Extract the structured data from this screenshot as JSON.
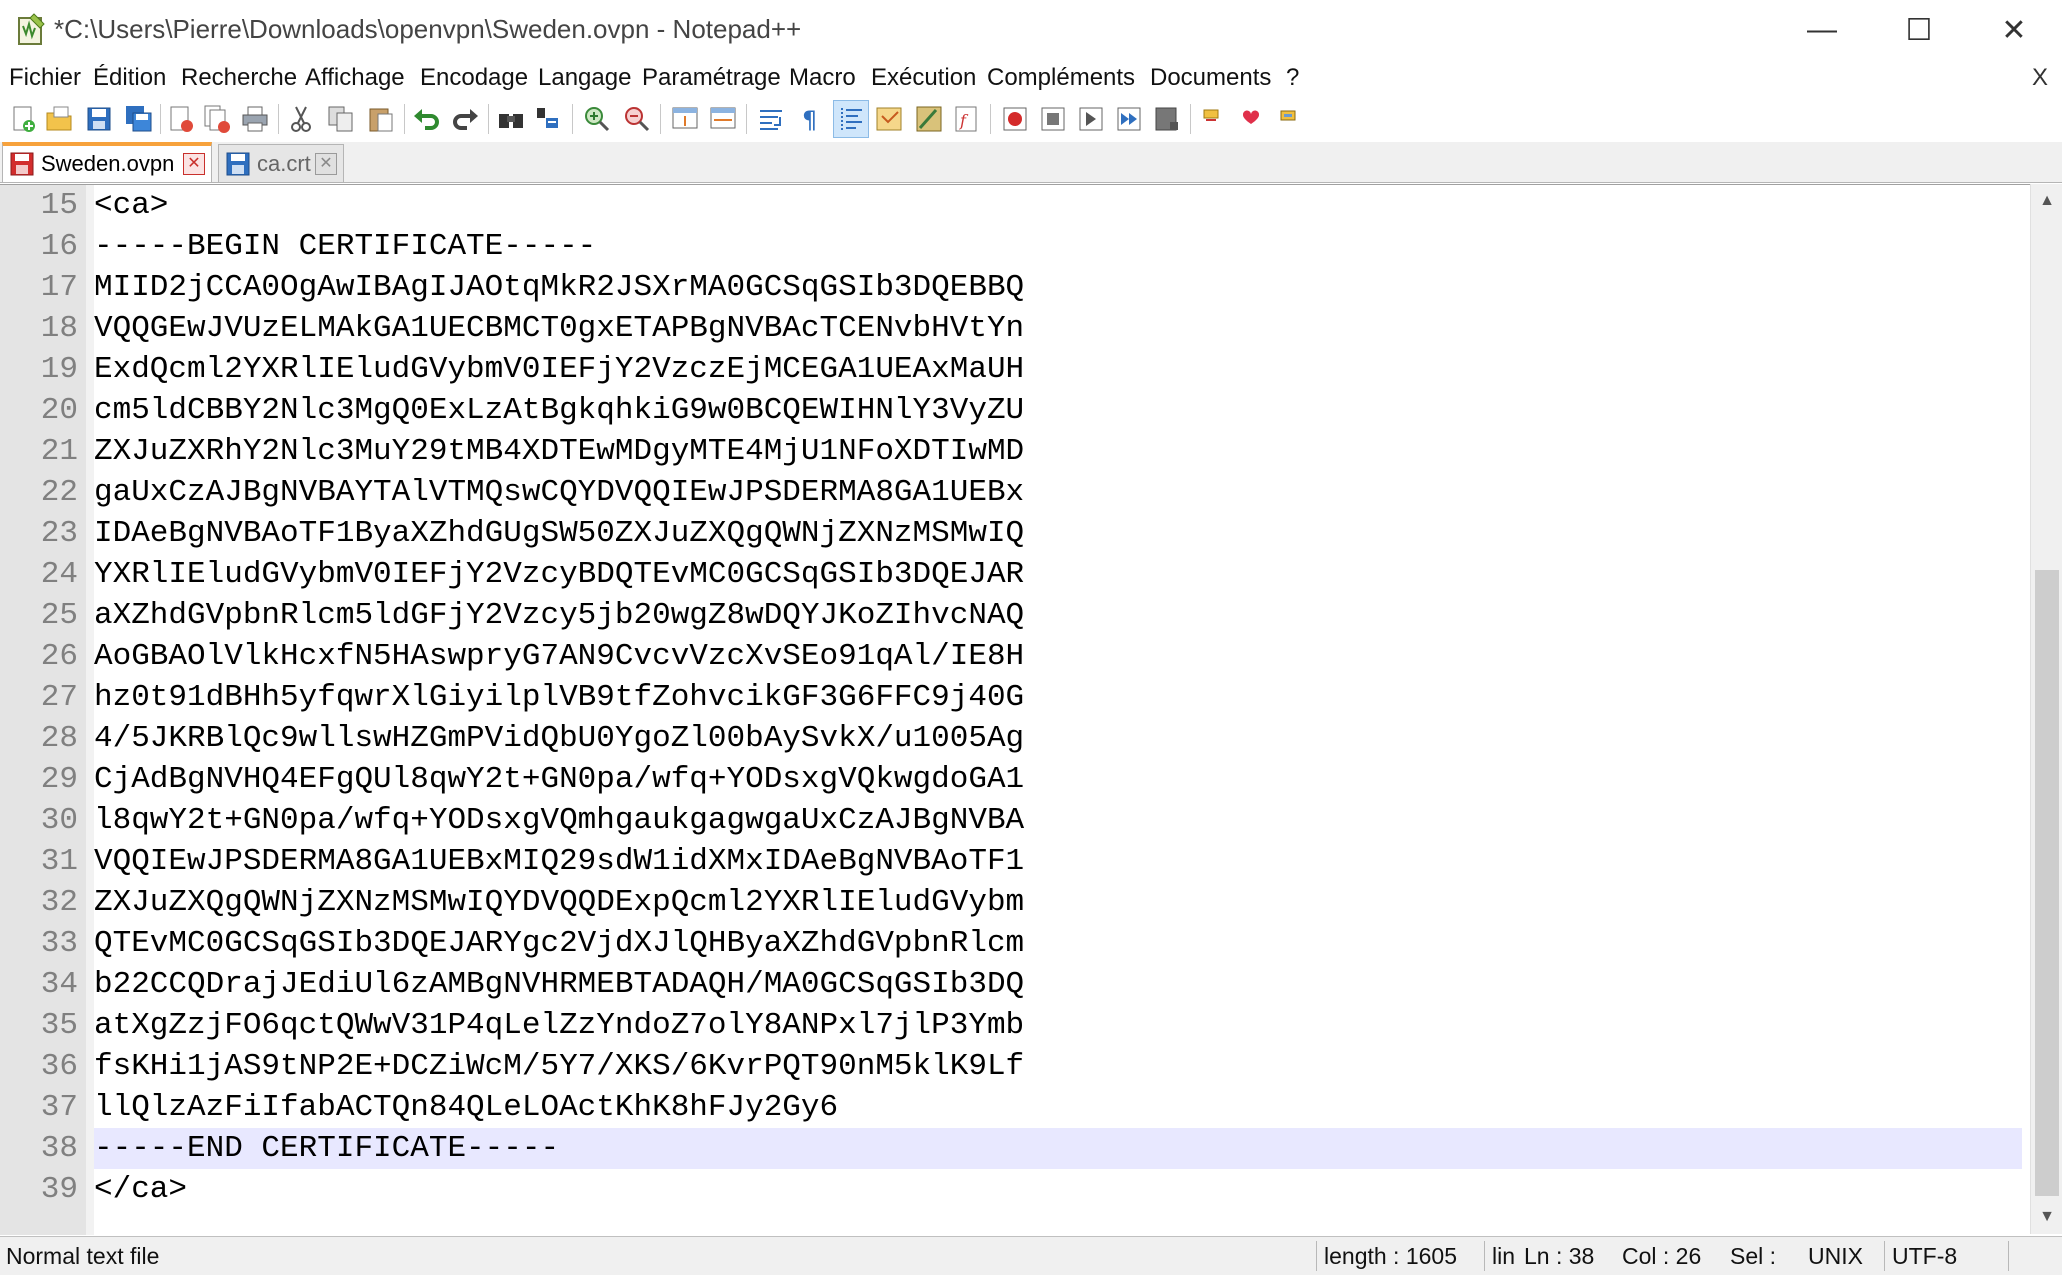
{
  "window": {
    "title": "*C:\\Users\\Pierre\\Downloads\\openvpn\\Sweden.ovpn - Notepad++",
    "minimize_symbol": "—",
    "maximize_symbol": "☐",
    "close_symbol": "✕"
  },
  "menu": {
    "items": [
      "Fichier",
      "Édition",
      "Recherche",
      "Affichage",
      "Encodage",
      "Langage",
      "Paramétrage",
      "Macro",
      "Exécution",
      "Compléments",
      "Documents",
      "?"
    ],
    "close_label": "X"
  },
  "toolbar": {
    "icons": [
      "new-file-icon",
      "open-file-icon",
      "save-icon",
      "save-all-icon",
      "close-icon",
      "close-all-icon",
      "print-icon",
      "cut-icon",
      "copy-icon",
      "paste-icon",
      "undo-icon",
      "redo-icon",
      "find-icon",
      "replace-icon",
      "zoom-in-icon",
      "zoom-out-icon",
      "sync-vertical-icon",
      "sync-horizontal-icon",
      "word-wrap-icon",
      "show-all-characters-icon",
      "indent-guide-icon",
      "language-icon",
      "document-map-icon",
      "function-list-icon",
      "record-macro-icon",
      "stop-macro-icon",
      "play-macro-icon",
      "run-macro-multiple-icon",
      "save-macro-icon",
      "bookmark-icon",
      "heart-icon",
      "plugin-icon"
    ]
  },
  "tabs": [
    {
      "label": "Sweden.ovpn",
      "close": "✕",
      "active": true,
      "icon": "unsaved-file-icon"
    },
    {
      "label": "ca.crt",
      "close": "✕",
      "active": false,
      "icon": "saved-file-icon"
    }
  ],
  "editor": {
    "current_line": 38,
    "lines": [
      {
        "num": "15",
        "text": "<ca>"
      },
      {
        "num": "16",
        "text": "-----BEGIN CERTIFICATE-----"
      },
      {
        "num": "17",
        "text": "MIID2jCCA0OgAwIBAgIJAOtqMkR2JSXrMA0GCSqGSIb3DQEBBQ"
      },
      {
        "num": "18",
        "text": "VQQGEwJVUzELMAkGA1UECBMCT0gxETAPBgNVBAcTCENvbHVtYn"
      },
      {
        "num": "19",
        "text": "ExdQcml2YXRlIEludGVybmV0IEFjY2VzczEjMCEGA1UEAxMaUH"
      },
      {
        "num": "20",
        "text": "cm5ldCBBY2Nlc3MgQ0ExLzAtBgkqhkiG9w0BCQEWIHNlY3VyZU"
      },
      {
        "num": "21",
        "text": "ZXJuZXRhY2Nlc3MuY29tMB4XDTEwMDgyMTE4MjU1NFoXDTIwMD"
      },
      {
        "num": "22",
        "text": "gaUxCzAJBgNVBAYTAlVTMQswCQYDVQQIEwJPSDERMA8GA1UEBx"
      },
      {
        "num": "23",
        "text": "IDAeBgNVBAoTF1ByaXZhdGUgSW50ZXJuZXQgQWNjZXNzMSMwIQ"
      },
      {
        "num": "24",
        "text": "YXRlIEludGVybmV0IEFjY2VzcyBDQTEvMC0GCSqGSIb3DQEJAR"
      },
      {
        "num": "25",
        "text": "aXZhdGVpbnRlcm5ldGFjY2Vzcy5jb20wgZ8wDQYJKoZIhvcNAQ"
      },
      {
        "num": "26",
        "text": "AoGBAOlVlkHcxfN5HAswpryG7AN9CvcvVzcXvSEo91qAl/IE8H"
      },
      {
        "num": "27",
        "text": "hz0t91dBHh5yfqwrXlGiyilplVB9tfZohvcikGF3G6FFC9j40G"
      },
      {
        "num": "28",
        "text": "4/5JKRBlQc9wllswHZGmPVidQbU0YgoZl00bAySvkX/u1005Ag"
      },
      {
        "num": "29",
        "text": "CjAdBgNVHQ4EFgQUl8qwY2t+GN0pa/wfq+YODsxgVQkwgdoGA1"
      },
      {
        "num": "30",
        "text": "l8qwY2t+GN0pa/wfq+YODsxgVQmhgaukgagwgaUxCzAJBgNVBA"
      },
      {
        "num": "31",
        "text": "VQQIEwJPSDERMA8GA1UEBxMIQ29sdW1idXMxIDAeBgNVBAoTF1"
      },
      {
        "num": "32",
        "text": "ZXJuZXQgQWNjZXNzMSMwIQYDVQQDExpQcml2YXRlIEludGVybm"
      },
      {
        "num": "33",
        "text": "QTEvMC0GCSqGSIb3DQEJARYgc2VjdXJlQHByaXZhdGVpbnRlcm"
      },
      {
        "num": "34",
        "text": "b22CCQDrajJEdiUl6zAMBgNVHRMEBTADAQH/MA0GCSqGSIb3DQ"
      },
      {
        "num": "35",
        "text": "atXgZzjFO6qctQWwV31P4qLelZzYndoZ7olY8ANPxl7jlP3Ymb"
      },
      {
        "num": "36",
        "text": "fsKHi1jAS9tNP2E+DCZiWcM/5Y7/XKS/6KvrPQT90nM5klK9Lf"
      },
      {
        "num": "37",
        "text": "llQlzAzFiIfabACTQn84QLeLOActKhK8hFJy2Gy6"
      },
      {
        "num": "38",
        "text": "-----END CERTIFICATE-----"
      },
      {
        "num": "39",
        "text": "</ca>"
      }
    ]
  },
  "scrollbar": {
    "up_arrow": "▲",
    "down_arrow": "▼"
  },
  "status": {
    "file_type": "Normal text file",
    "length": "length : 1605",
    "lines": "lin",
    "position": "Ln : 38",
    "column": "Col : 26",
    "selection": "Sel :",
    "eol": "UNIX",
    "encoding": "UTF-8"
  },
  "colors": {
    "active_tab_accent": "#f7a23c",
    "current_line_bg": "#e8e8ff",
    "gutter_bg": "#e4e4e4"
  }
}
